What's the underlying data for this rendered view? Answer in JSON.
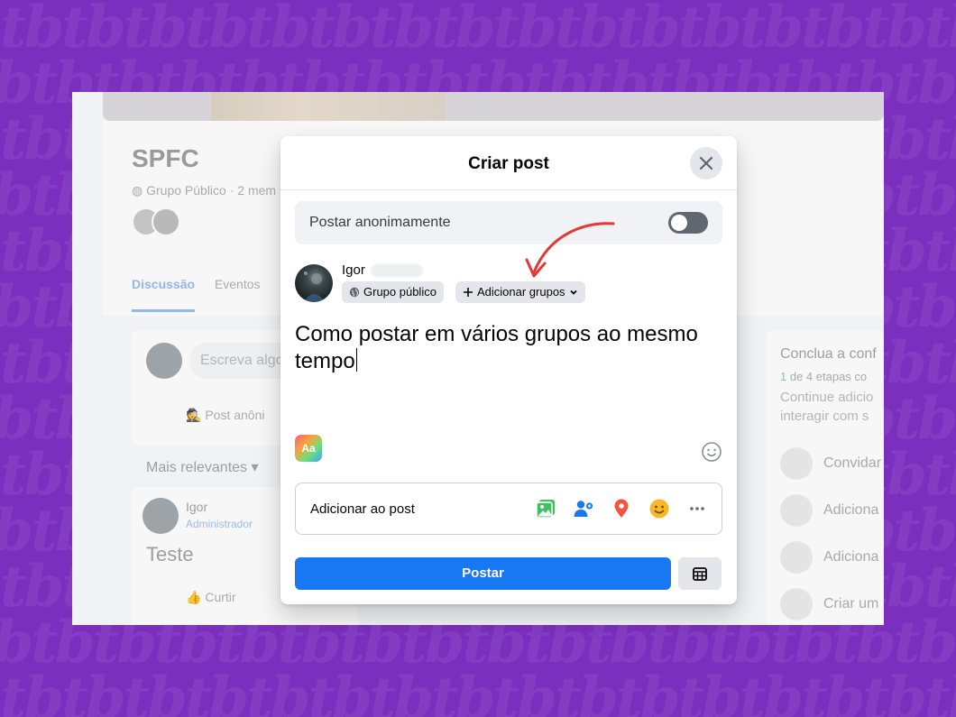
{
  "background_pattern": "tbtbtbtbtbtbtbtbtbtbtbtbtbtbtbtbtbtbtbtbtbtbtbtb",
  "page": {
    "group_name": "SPFC",
    "group_meta": "Grupo Público · 2 mem",
    "tabs": [
      "Discussão",
      "Eventos"
    ],
    "composer_placeholder": "Escreva algo",
    "composer_anon": "Post anôni",
    "sort_label": "Mais relevantes",
    "post": {
      "author": "Igor",
      "role": "Administrador",
      "text": "Teste",
      "like": "Curtir"
    },
    "sidebar": {
      "title": "Conclua a conf",
      "progress_current": "1",
      "progress_text": "de 4 etapas co",
      "desc_line1": "Continue adicio",
      "desc_line2": "interagir com s",
      "items": [
        "Convidar",
        "Adiciona",
        "Adiciona",
        "Criar um"
      ]
    }
  },
  "dialog": {
    "title": "Criar post",
    "anon_label": "Postar anonimamente",
    "anon_enabled": false,
    "author": "Igor",
    "privacy_label": "Grupo público",
    "add_groups_label": "Adicionar grupos",
    "post_text": "Como postar em vários grupos ao mesmo tempo",
    "text_format_label": "Aa",
    "add_to_post_label": "Adicionar ao post",
    "add_icons": [
      "photo-video-icon",
      "tag-people-icon",
      "location-pin-icon",
      "feeling-emoji-icon",
      "more-icon"
    ],
    "submit_label": "Postar"
  },
  "colors": {
    "background": "#7b2fbe",
    "primary": "#1877f2",
    "annotation_arrow": "#e53935"
  }
}
